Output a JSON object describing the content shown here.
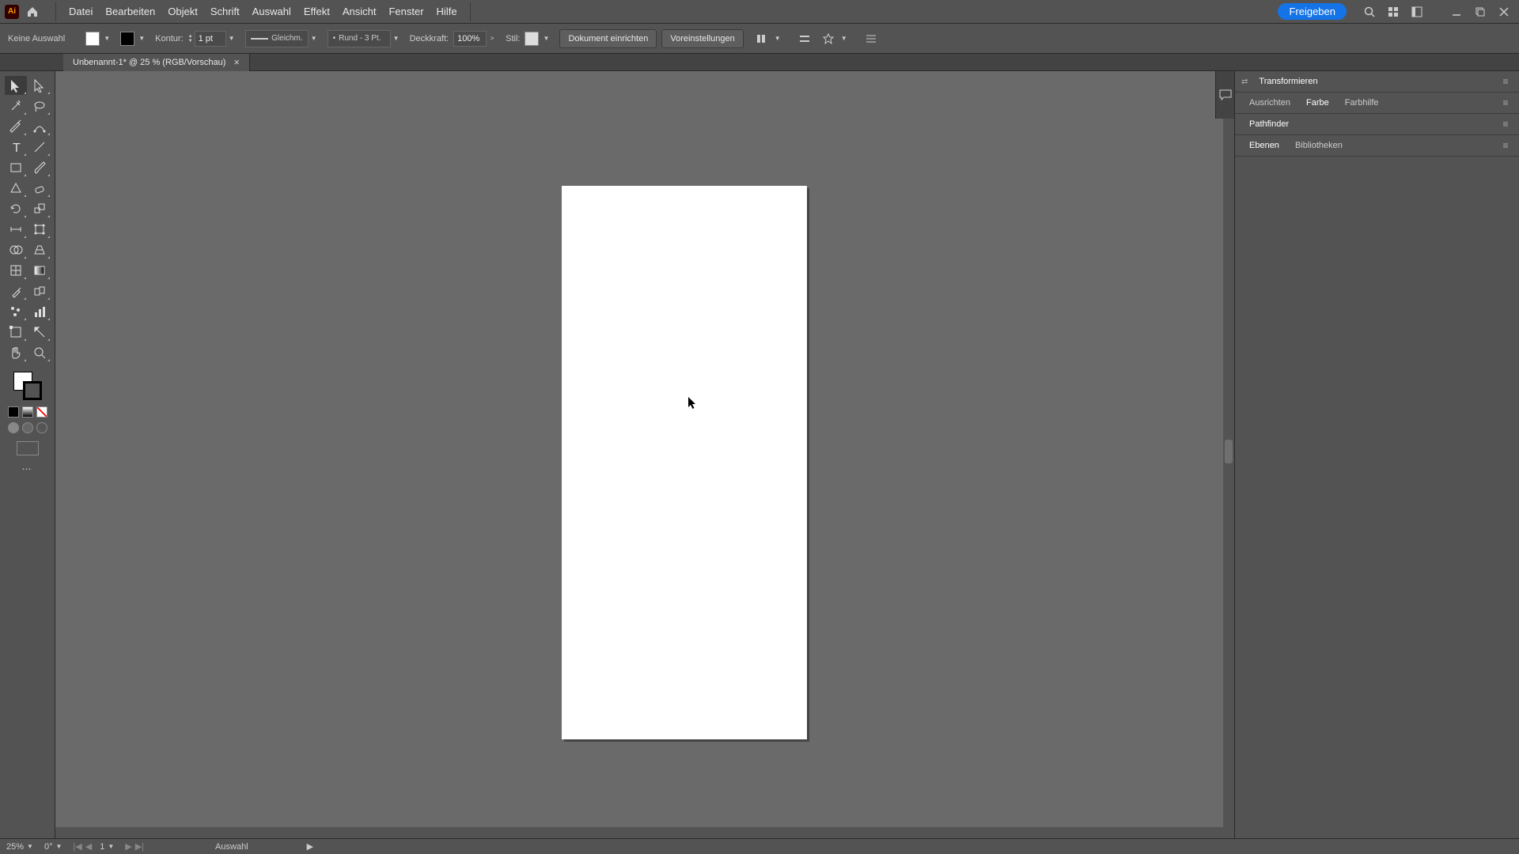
{
  "app": {
    "icon_text": "Ai"
  },
  "menu": [
    "Datei",
    "Bearbeiten",
    "Objekt",
    "Schrift",
    "Auswahl",
    "Effekt",
    "Ansicht",
    "Fenster",
    "Hilfe"
  ],
  "share_label": "Freigeben",
  "control": {
    "no_selection": "Keine Auswahl",
    "stroke_label": "Kontur:",
    "stroke_value": "1 pt",
    "profile_label": "Gleichm.",
    "brush_label": "Rund - 3 Pt.",
    "opacity_label": "Deckkraft:",
    "opacity_value": "100%",
    "style_label": "Stil:",
    "doc_setup": "Dokument einrichten",
    "prefs": "Voreinstellungen"
  },
  "document_tab": "Unbenannt-1* @ 25 % (RGB/Vorschau)",
  "tools": [
    [
      "selection",
      "direct-selection"
    ],
    [
      "magic-wand",
      "lasso"
    ],
    [
      "pen",
      "curvature"
    ],
    [
      "type",
      "line-segment"
    ],
    [
      "rectangle",
      "paintbrush"
    ],
    [
      "shaper",
      "eraser"
    ],
    [
      "rotate",
      "scale"
    ],
    [
      "width",
      "free-transform"
    ],
    [
      "shape-builder",
      "perspective"
    ],
    [
      "mesh",
      "gradient"
    ],
    [
      "eyedropper",
      "blend"
    ],
    [
      "symbol-sprayer",
      "column-graph"
    ],
    [
      "artboard",
      "slice"
    ],
    [
      "hand",
      "zoom"
    ]
  ],
  "panels": {
    "g1": {
      "tabs": [
        "Transformieren"
      ],
      "active": 0
    },
    "g2": {
      "tabs": [
        "Ausrichten",
        "Farbe",
        "Farbhilfe"
      ],
      "active": 1
    },
    "g3": {
      "tabs": [
        "Pathfinder"
      ],
      "active": 0
    },
    "g4": {
      "tabs": [
        "Ebenen",
        "Bibliotheken"
      ],
      "active": 0
    }
  },
  "status": {
    "zoom": "25%",
    "angle": "0°",
    "artboard": "1",
    "tool": "Auswahl"
  }
}
